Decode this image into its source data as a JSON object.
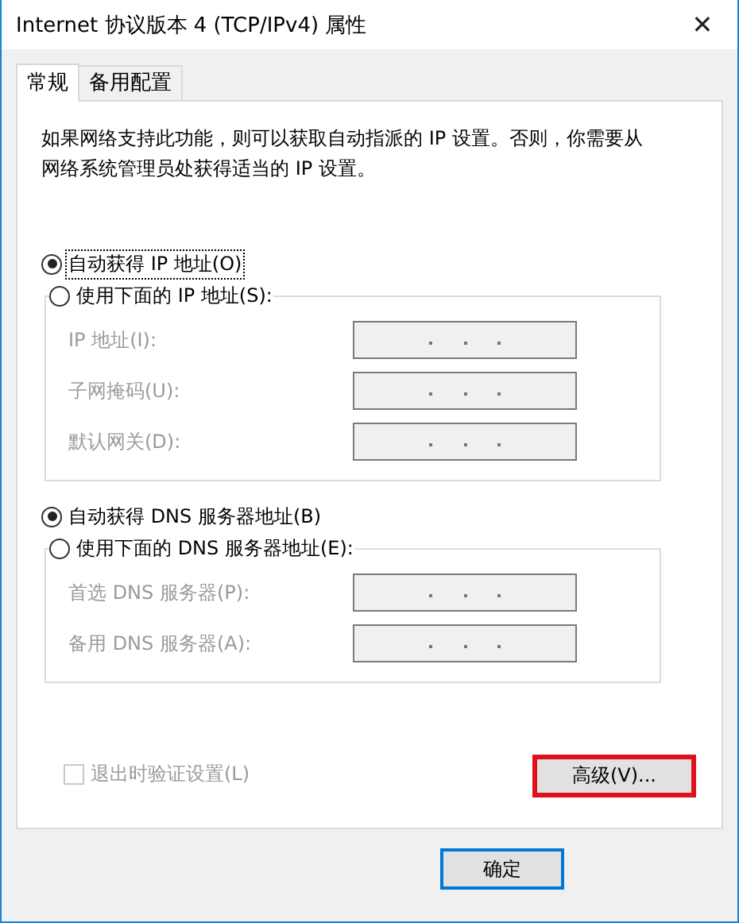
{
  "window": {
    "title": "Internet 协议版本 4 (TCP/IPv4) 属性",
    "close": "✕"
  },
  "tabs": [
    {
      "label": "常规",
      "selected": true
    },
    {
      "label": "备用配置",
      "selected": false
    }
  ],
  "description": "如果网络支持此功能，则可以获取自动指派的 IP 设置。否则，你需要从网络系统管理员处获得适当的 IP 设置。",
  "ip_section": {
    "auto": {
      "label": "自动获得 IP 地址(O)",
      "selected": true,
      "focused": true
    },
    "manual": {
      "label": "使用下面的 IP 地址(S):",
      "selected": false
    },
    "fields": [
      {
        "label": "IP 地址(I):",
        "disabled": true
      },
      {
        "label": "子网掩码(U):",
        "disabled": true
      },
      {
        "label": "默认网关(D):",
        "disabled": true
      }
    ]
  },
  "dns_section": {
    "auto": {
      "label": "自动获得 DNS 服务器地址(B)",
      "selected": true,
      "focused": false
    },
    "manual": {
      "label": "使用下面的 DNS 服务器地址(E):",
      "selected": false
    },
    "fields": [
      {
        "label": "首选 DNS 服务器(P):",
        "disabled": true
      },
      {
        "label": "备用 DNS 服务器(A):",
        "disabled": true
      }
    ]
  },
  "validate": {
    "label": "退出时验证设置(L)",
    "checked": false,
    "disabled": true
  },
  "advanced_button": {
    "label": "高级(V)...",
    "highlighted": true
  },
  "ok_button": {
    "label": "确定"
  }
}
